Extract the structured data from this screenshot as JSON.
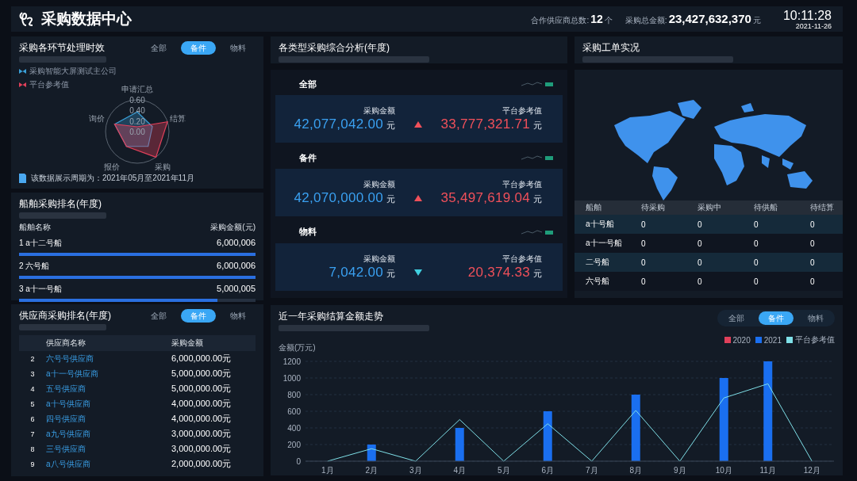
{
  "header": {
    "title": "采购数据中心",
    "supplier_count": {
      "label": "合作供应商总数:",
      "value": "12",
      "unit": "个"
    },
    "total_amount": {
      "label": "采购总金额:",
      "value": "23,427,632,370",
      "unit": "元"
    },
    "time": "10:11:28",
    "date": "2021-11-26"
  },
  "efficiency_panel": {
    "title": "采购各环节处理时效",
    "tabs": [
      {
        "label": "全部",
        "selected": false
      },
      {
        "label": "备件",
        "selected": true
      },
      {
        "label": "物料",
        "selected": false
      }
    ],
    "radar": {
      "axes": [
        "申请汇总",
        "结算",
        "采购",
        "报价",
        "询价"
      ],
      "ticks": [
        "0.60",
        "0.40",
        "0.20",
        "0.00"
      ],
      "series": [
        {
          "name": "采购智能大屏测试主公司",
          "color": "#3aa0d8"
        },
        {
          "name": "平台参考值",
          "color": "#e0405a"
        }
      ]
    },
    "note": "该数据展示周期为：2021年05月至2021年11月"
  },
  "ship_ranking": {
    "title": "船舶采购排名(年度)",
    "columns": [
      "船舶名称",
      "采购金额(元)"
    ],
    "rows": [
      {
        "rank": "1",
        "name": "a十二号船",
        "amount": "6,000,006",
        "level": 1
      },
      {
        "rank": "2",
        "name": "六号船",
        "amount": "6,000,006",
        "level": 1
      },
      {
        "rank": "3",
        "name": "a十一号船",
        "amount": "5,000,005",
        "level": 0.84
      }
    ]
  },
  "supplier_ranking": {
    "title": "供应商采购排名(年度)",
    "tabs": [
      {
        "label": "全部",
        "selected": false
      },
      {
        "label": "备件",
        "selected": true
      },
      {
        "label": "物料",
        "selected": false
      }
    ],
    "columns": [
      "供应商名称",
      "采购金额"
    ],
    "rows": [
      {
        "rank": "2",
        "name": "六号号供应商",
        "amount": "6,000,000.00元"
      },
      {
        "rank": "3",
        "name": "a十一号供应商",
        "amount": "5,000,000.00元"
      },
      {
        "rank": "4",
        "name": "五号供应商",
        "amount": "5,000,000.00元"
      },
      {
        "rank": "5",
        "name": "a十号供应商",
        "amount": "4,000,000.00元"
      },
      {
        "rank": "6",
        "name": "四号供应商",
        "amount": "4,000,000.00元"
      },
      {
        "rank": "7",
        "name": "a九号供应商",
        "amount": "3,000,000.00元"
      },
      {
        "rank": "8",
        "name": "三号供应商",
        "amount": "3,000,000.00元"
      },
      {
        "rank": "9",
        "name": "a八号供应商",
        "amount": "2,000,000.00元"
      }
    ]
  },
  "category_analysis": {
    "title": "各类型采购综合分析(年度)",
    "sections": [
      {
        "name": "全部",
        "amount_label": "采购金额",
        "amount": "42,077,042.00",
        "amount_unit": "元",
        "increase": true,
        "reference_label": "平台参考值",
        "reference": "33,777,321.71",
        "reference_unit": "元"
      },
      {
        "name": "备件",
        "amount_label": "采购金额",
        "amount": "42,070,000.00",
        "amount_unit": "元",
        "increase": true,
        "reference_label": "平台参考值",
        "reference": "35,497,619.04",
        "reference_unit": "元"
      },
      {
        "name": "物料",
        "amount_label": "采购金额",
        "amount": "7,042.00",
        "amount_unit": "元",
        "increase": false,
        "reference_label": "平台参考值",
        "reference": "20,374.33",
        "reference_unit": "元"
      }
    ]
  },
  "work_orders": {
    "title": "采购工单实况",
    "columns": [
      "船舶",
      "待采购",
      "采购中",
      "待供船",
      "待结算"
    ],
    "rows": [
      [
        "a十号船",
        "0",
        "0",
        "0",
        "0"
      ],
      [
        "a十一号船",
        "0",
        "0",
        "0",
        "0"
      ],
      [
        "二号船",
        "0",
        "0",
        "0",
        "0"
      ],
      [
        "六号船",
        "0",
        "0",
        "0",
        "0"
      ]
    ]
  },
  "trend_panel": {
    "title": "近一年采购结算金额走势",
    "tabs": [
      {
        "label": "全部",
        "selected": false
      },
      {
        "label": "备件",
        "selected": true
      },
      {
        "label": "物料",
        "selected": false
      }
    ],
    "chart_data": {
      "type": "bar",
      "ylabel": "金额(万元)",
      "categories": [
        "1月",
        "2月",
        "3月",
        "4月",
        "5月",
        "6月",
        "7月",
        "8月",
        "9月",
        "10月",
        "11月",
        "12月"
      ],
      "series": [
        {
          "name": "2020",
          "color": "#e0405a",
          "values": [
            null,
            null,
            null,
            null,
            null,
            null,
            null,
            null,
            null,
            null,
            null,
            null
          ]
        },
        {
          "name": "2021",
          "color": "#1a6ff0",
          "values": [
            0,
            200,
            0,
            400,
            0,
            600,
            0,
            800,
            0,
            1000,
            1200,
            0
          ]
        },
        {
          "name": "平台参考值",
          "color": "#7fe0e8",
          "type": "line",
          "values": [
            0,
            150,
            0,
            500,
            0,
            450,
            0,
            610,
            0,
            760,
            930,
            0
          ]
        }
      ],
      "grid": true,
      "ylim": [
        0,
        1200
      ],
      "yticks": [
        0,
        200,
        400,
        600,
        800,
        1000,
        1200
      ]
    }
  }
}
